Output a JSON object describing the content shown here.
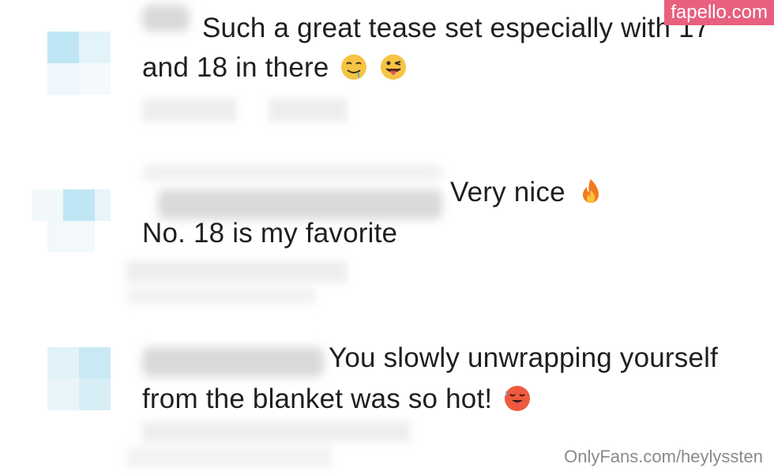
{
  "watermark": {
    "label": "fapello.com"
  },
  "footer": {
    "source": "OnlyFans.com/heylyssten"
  },
  "comments": [
    {
      "line1": "Such a great tease set especially with 17",
      "line2": "and 18 in there",
      "emojis": [
        "drooling-face",
        "winking-face-with-tongue"
      ]
    },
    {
      "line1": "Very nice",
      "line1_emoji": "fire",
      "line2": "No. 18 is my favorite"
    },
    {
      "line1": "You slowly unwrapping yourself",
      "line2": "from the blanket was so hot!",
      "line2_emoji": "hot-face"
    }
  ],
  "colors": {
    "watermark_bg": "#e8607e",
    "text": "#1f1f1f",
    "footer_text": "#8a8a8a"
  }
}
